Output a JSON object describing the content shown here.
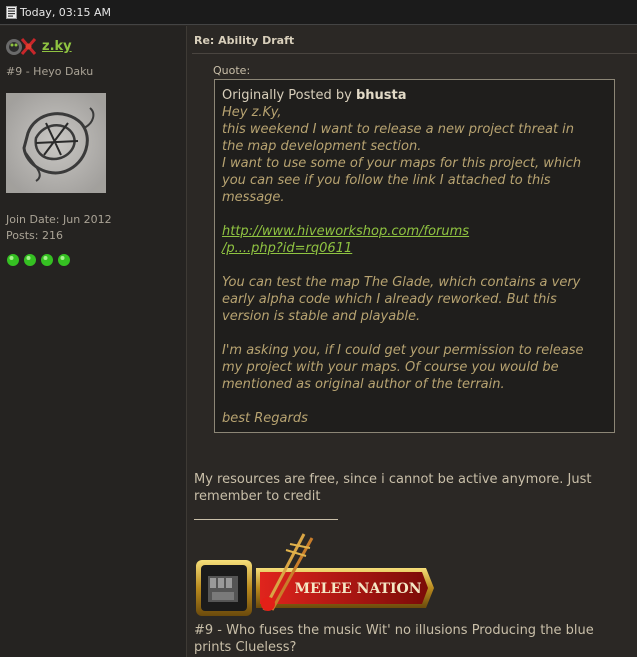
{
  "header": {
    "date": "Today, 03:15 AM",
    "icon": "post-icon"
  },
  "user": {
    "name": "z.ky",
    "title": "#9 - Heyo Daku",
    "join_date": "Join Date: Jun 2012",
    "posts": "Posts: 216",
    "reputation_dots": 4,
    "rep_color": "#35c022"
  },
  "post": {
    "title": "Re: Ability Draft",
    "quote_label": "Quote:",
    "quote": {
      "prefix": "Originally Posted by",
      "author": "bhusta",
      "lines": [
        "Hey z.Ky,",
        "this weekend I want to release a new project threat in",
        "the map development section.",
        "I want to use some of your maps for this project, which",
        "you can see if you follow the link I attached to this",
        "message."
      ],
      "link_line1": "http://www.hiveworkshop.com/forums",
      "link_line2": "/p....php?id=rq0611",
      "para2": [
        "You can test the map The Glade, which contains a very",
        "early alpha code which I already reworked. But this",
        "version is stable and playable."
      ],
      "para3": [
        "I'm asking you, if I could get your permission to release",
        "my project with your maps. Of course you would be",
        "mentioned as original author of the terrain."
      ],
      "closing": "best Regards"
    },
    "reply": [
      "My resources are free, since i cannot be active anymore. Just",
      "remember to credit"
    ],
    "signature": {
      "banner_text": "MELEE NATION",
      "line1": "#9 - Who fuses the music Wit' no illusions Producing the blue",
      "line2": "prints Clueless?"
    }
  }
}
